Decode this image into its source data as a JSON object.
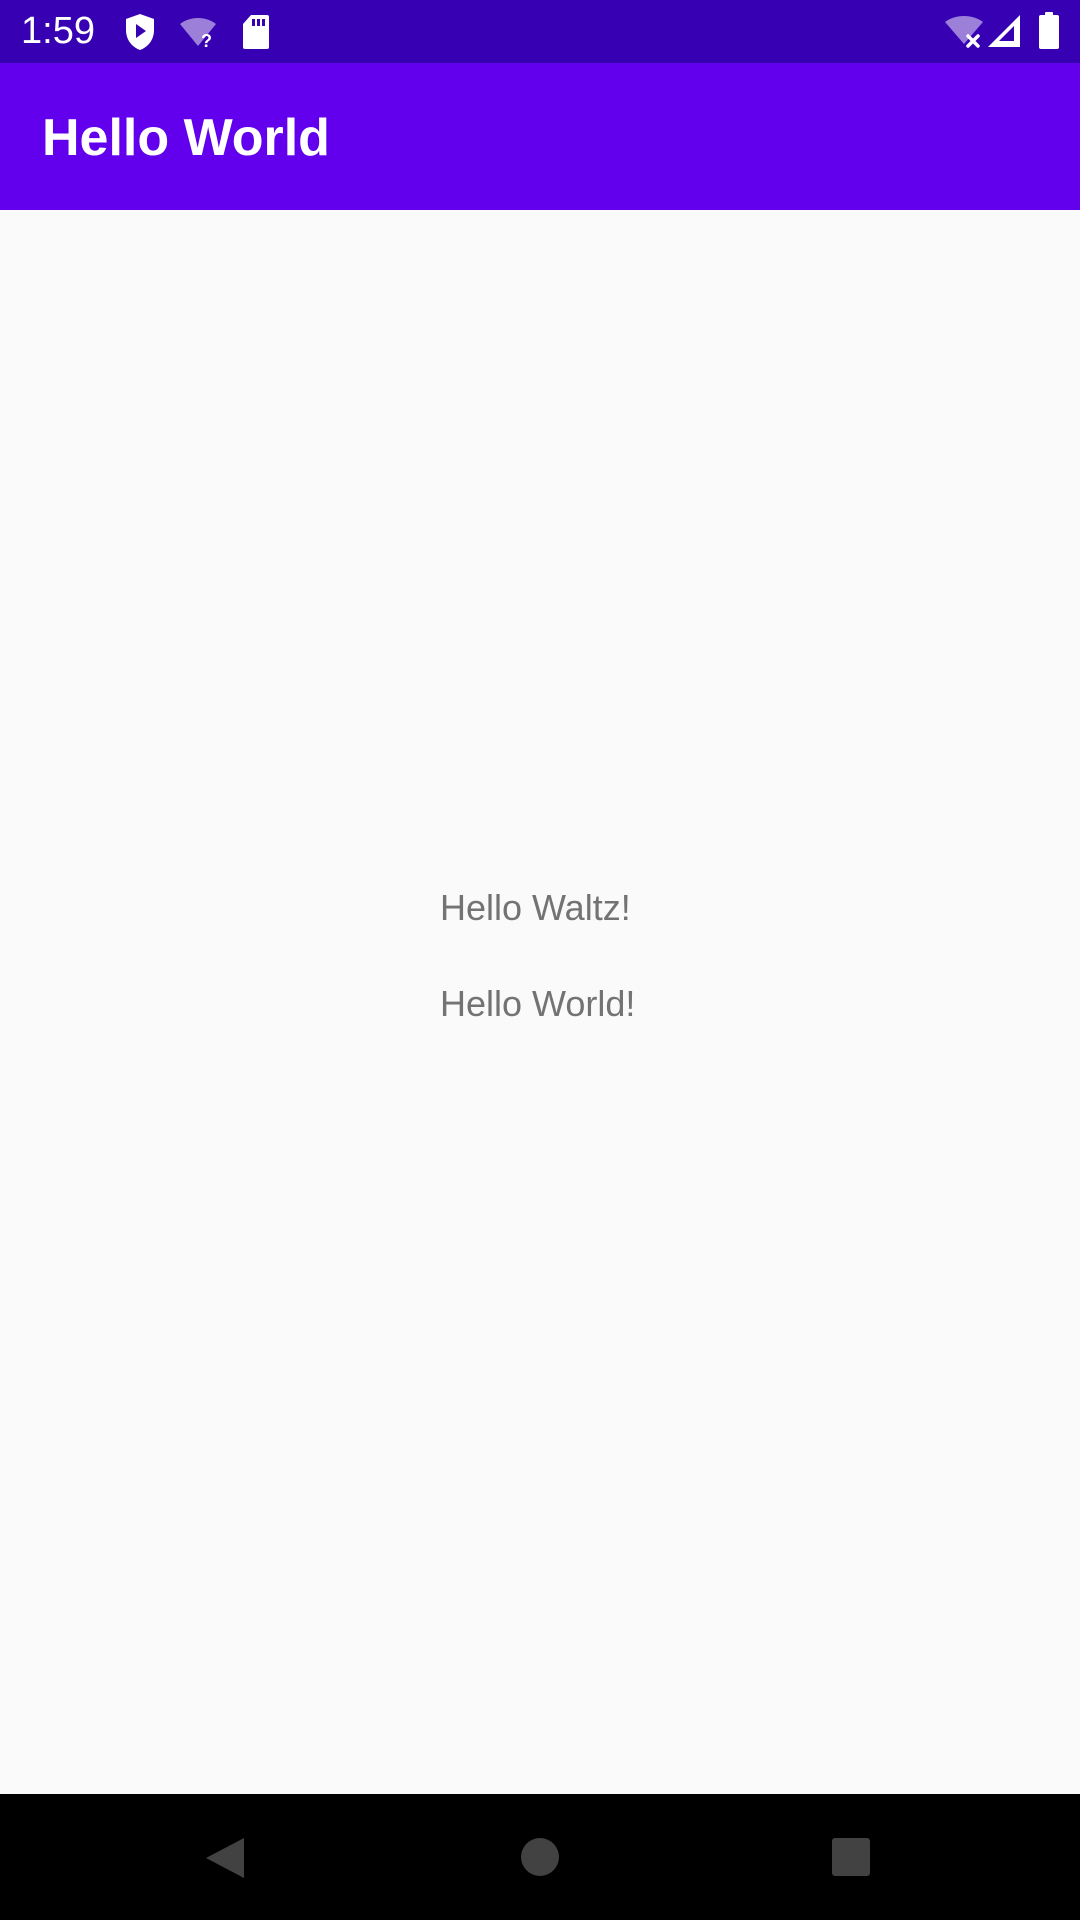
{
  "status_bar": {
    "time": "1:59",
    "icons_left": [
      "play-protect-icon",
      "wifi-question-icon",
      "sd-card-icon"
    ],
    "icons_right": [
      "wifi-off-icon",
      "signal-icon",
      "battery-icon"
    ],
    "background": "#3700b3"
  },
  "app_bar": {
    "title": "Hello World",
    "background": "#6200ee"
  },
  "content": {
    "lines": [
      "Hello Waltz!",
      "Hello World!"
    ],
    "text_color": "#737373",
    "background": "#fafafa"
  },
  "nav_bar": {
    "buttons": [
      "back-icon",
      "home-icon",
      "recents-icon"
    ],
    "background": "#000000"
  }
}
